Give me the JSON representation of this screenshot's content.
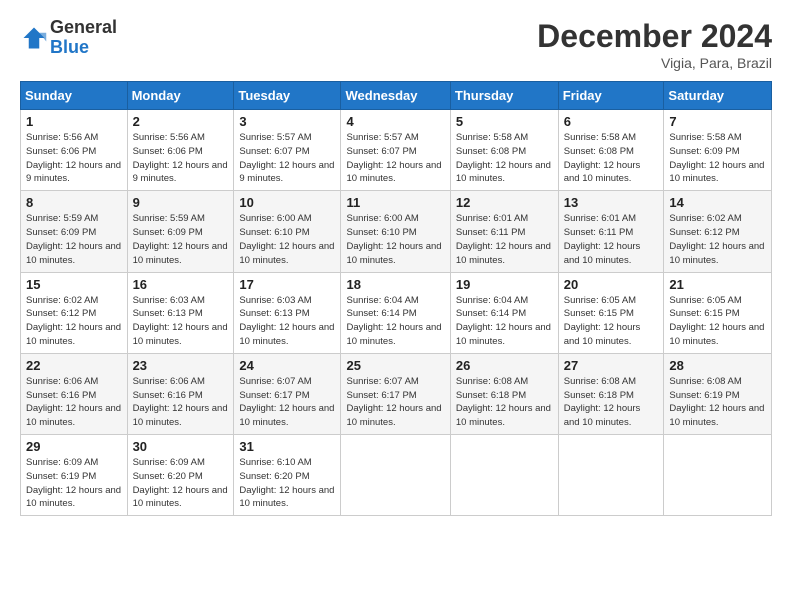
{
  "logo": {
    "general": "General",
    "blue": "Blue"
  },
  "header": {
    "month": "December 2024",
    "location": "Vigia, Para, Brazil"
  },
  "weekdays": [
    "Sunday",
    "Monday",
    "Tuesday",
    "Wednesday",
    "Thursday",
    "Friday",
    "Saturday"
  ],
  "weeks": [
    [
      {
        "day": "1",
        "sunrise": "5:56 AM",
        "sunset": "6:06 PM",
        "daylight": "12 hours and 9 minutes."
      },
      {
        "day": "2",
        "sunrise": "5:56 AM",
        "sunset": "6:06 PM",
        "daylight": "12 hours and 9 minutes."
      },
      {
        "day": "3",
        "sunrise": "5:57 AM",
        "sunset": "6:07 PM",
        "daylight": "12 hours and 9 minutes."
      },
      {
        "day": "4",
        "sunrise": "5:57 AM",
        "sunset": "6:07 PM",
        "daylight": "12 hours and 10 minutes."
      },
      {
        "day": "5",
        "sunrise": "5:58 AM",
        "sunset": "6:08 PM",
        "daylight": "12 hours and 10 minutes."
      },
      {
        "day": "6",
        "sunrise": "5:58 AM",
        "sunset": "6:08 PM",
        "daylight": "12 hours and 10 minutes."
      },
      {
        "day": "7",
        "sunrise": "5:58 AM",
        "sunset": "6:09 PM",
        "daylight": "12 hours and 10 minutes."
      }
    ],
    [
      {
        "day": "8",
        "sunrise": "5:59 AM",
        "sunset": "6:09 PM",
        "daylight": "12 hours and 10 minutes."
      },
      {
        "day": "9",
        "sunrise": "5:59 AM",
        "sunset": "6:09 PM",
        "daylight": "12 hours and 10 minutes."
      },
      {
        "day": "10",
        "sunrise": "6:00 AM",
        "sunset": "6:10 PM",
        "daylight": "12 hours and 10 minutes."
      },
      {
        "day": "11",
        "sunrise": "6:00 AM",
        "sunset": "6:10 PM",
        "daylight": "12 hours and 10 minutes."
      },
      {
        "day": "12",
        "sunrise": "6:01 AM",
        "sunset": "6:11 PM",
        "daylight": "12 hours and 10 minutes."
      },
      {
        "day": "13",
        "sunrise": "6:01 AM",
        "sunset": "6:11 PM",
        "daylight": "12 hours and 10 minutes."
      },
      {
        "day": "14",
        "sunrise": "6:02 AM",
        "sunset": "6:12 PM",
        "daylight": "12 hours and 10 minutes."
      }
    ],
    [
      {
        "day": "15",
        "sunrise": "6:02 AM",
        "sunset": "6:12 PM",
        "daylight": "12 hours and 10 minutes."
      },
      {
        "day": "16",
        "sunrise": "6:03 AM",
        "sunset": "6:13 PM",
        "daylight": "12 hours and 10 minutes."
      },
      {
        "day": "17",
        "sunrise": "6:03 AM",
        "sunset": "6:13 PM",
        "daylight": "12 hours and 10 minutes."
      },
      {
        "day": "18",
        "sunrise": "6:04 AM",
        "sunset": "6:14 PM",
        "daylight": "12 hours and 10 minutes."
      },
      {
        "day": "19",
        "sunrise": "6:04 AM",
        "sunset": "6:14 PM",
        "daylight": "12 hours and 10 minutes."
      },
      {
        "day": "20",
        "sunrise": "6:05 AM",
        "sunset": "6:15 PM",
        "daylight": "12 hours and 10 minutes."
      },
      {
        "day": "21",
        "sunrise": "6:05 AM",
        "sunset": "6:15 PM",
        "daylight": "12 hours and 10 minutes."
      }
    ],
    [
      {
        "day": "22",
        "sunrise": "6:06 AM",
        "sunset": "6:16 PM",
        "daylight": "12 hours and 10 minutes."
      },
      {
        "day": "23",
        "sunrise": "6:06 AM",
        "sunset": "6:16 PM",
        "daylight": "12 hours and 10 minutes."
      },
      {
        "day": "24",
        "sunrise": "6:07 AM",
        "sunset": "6:17 PM",
        "daylight": "12 hours and 10 minutes."
      },
      {
        "day": "25",
        "sunrise": "6:07 AM",
        "sunset": "6:17 PM",
        "daylight": "12 hours and 10 minutes."
      },
      {
        "day": "26",
        "sunrise": "6:08 AM",
        "sunset": "6:18 PM",
        "daylight": "12 hours and 10 minutes."
      },
      {
        "day": "27",
        "sunrise": "6:08 AM",
        "sunset": "6:18 PM",
        "daylight": "12 hours and 10 minutes."
      },
      {
        "day": "28",
        "sunrise": "6:08 AM",
        "sunset": "6:19 PM",
        "daylight": "12 hours and 10 minutes."
      }
    ],
    [
      {
        "day": "29",
        "sunrise": "6:09 AM",
        "sunset": "6:19 PM",
        "daylight": "12 hours and 10 minutes."
      },
      {
        "day": "30",
        "sunrise": "6:09 AM",
        "sunset": "6:20 PM",
        "daylight": "12 hours and 10 minutes."
      },
      {
        "day": "31",
        "sunrise": "6:10 AM",
        "sunset": "6:20 PM",
        "daylight": "12 hours and 10 minutes."
      },
      null,
      null,
      null,
      null
    ]
  ],
  "labels": {
    "sunrise": "Sunrise:",
    "sunset": "Sunset:",
    "daylight": "Daylight:"
  }
}
